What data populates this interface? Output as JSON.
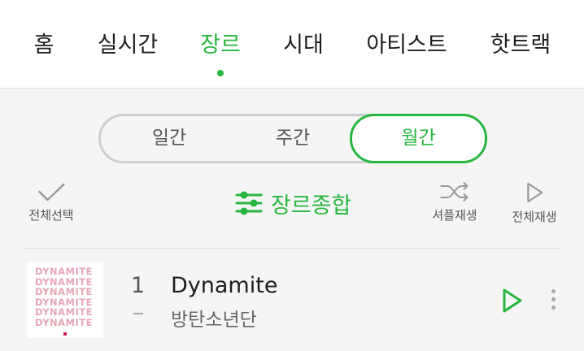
{
  "nav": {
    "items": [
      {
        "label": "홈",
        "active": false
      },
      {
        "label": "실시간",
        "active": false
      },
      {
        "label": "장르",
        "active": true
      },
      {
        "label": "시대",
        "active": false
      },
      {
        "label": "아티스트",
        "active": false
      },
      {
        "label": "핫트랙",
        "active": false
      }
    ]
  },
  "period_tabs": [
    {
      "label": "일간",
      "active": false
    },
    {
      "label": "주간",
      "active": false
    },
    {
      "label": "월간",
      "active": true
    }
  ],
  "controls": {
    "select_all": {
      "label": "전체선택",
      "icon": "check-icon"
    },
    "genre": {
      "label": "장르종합",
      "icon": "sliders-icon"
    },
    "shuffle": {
      "label": "셔플재생",
      "icon": "shuffle-icon"
    },
    "play_all": {
      "label": "전체재생",
      "icon": "play-icon"
    }
  },
  "tracks": [
    {
      "rank": "1",
      "title": "Dynamite",
      "artist": "방탄소년단",
      "album_art_text": "DYNAMITE",
      "rank_change": "-"
    }
  ],
  "colors": {
    "accent": "#27b63f",
    "text": "#1d1d1d",
    "muted": "#555555",
    "background": "#f5f5f5"
  }
}
